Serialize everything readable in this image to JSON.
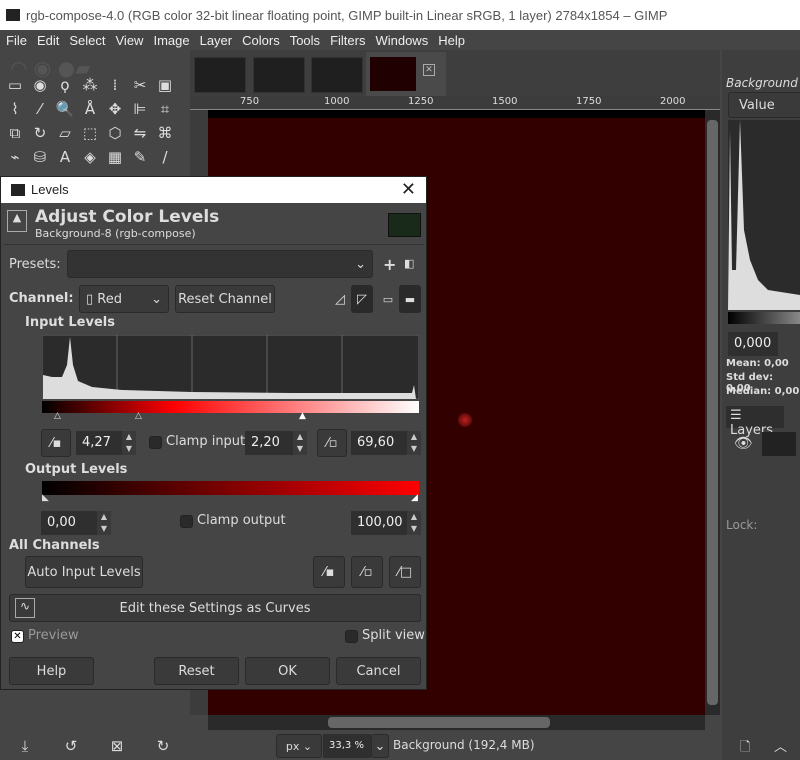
{
  "window": {
    "title": "rgb-compose-4.0 (RGB color 32-bit linear floating point, GIMP built-in Linear sRGB, 1 layer) 2784x1854 – GIMP"
  },
  "menu": [
    "File",
    "Edit",
    "Select",
    "View",
    "Image",
    "Layer",
    "Colors",
    "Tools",
    "Filters",
    "Windows",
    "Help"
  ],
  "ruler": [
    "750",
    "1000",
    "1250",
    "1500",
    "1750",
    "2000"
  ],
  "status": {
    "unit": "px",
    "zoom": "33,3 %",
    "layer_info": "Background (192,4 MB)"
  },
  "right_panel": {
    "dock_title": "Background",
    "channel": "Value",
    "value": "0,000",
    "stats": [
      {
        "label": "Mean:",
        "value": "0,00"
      },
      {
        "label": "Std dev:",
        "value": "0,00"
      },
      {
        "label": "Median:",
        "value": "0,00"
      }
    ],
    "layers_tab": "Layers",
    "lock_label": "Lock:"
  },
  "levels": {
    "window_title": "Levels",
    "heading": "Adjust Color Levels",
    "subheading": "Background-8 (rgb-compose)",
    "presets_label": "Presets:",
    "presets_value": "",
    "channel_label": "Channel:",
    "channel_value": "Red",
    "reset_channel": "Reset Channel",
    "input_levels": "Input Levels",
    "input_low": "4,27",
    "clamp_input": "Clamp input",
    "input_gamma": "2,20",
    "input_high": "69,60",
    "output_levels": "Output Levels",
    "output_low": "0,00",
    "clamp_output": "Clamp output",
    "output_high": "100,00",
    "all_channels": "All Channels",
    "auto_input": "Auto Input Levels",
    "curves": "Edit these Settings as Curves",
    "preview": "Preview",
    "preview_checked": true,
    "split_view": "Split view",
    "split_checked": false,
    "clamp_input_checked": false,
    "clamp_output_checked": false,
    "buttons": {
      "help": "Help",
      "reset": "Reset",
      "ok": "OK",
      "cancel": "Cancel"
    },
    "colors": {
      "output_gradient_end": "#ff0000",
      "swatch": "#1a2a1a"
    }
  }
}
